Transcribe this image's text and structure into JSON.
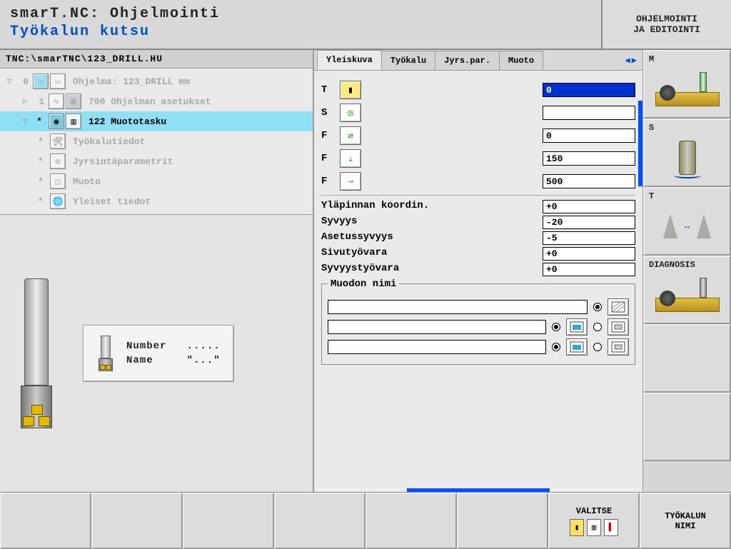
{
  "header": {
    "title": "smarT.NC: Ohjelmointi",
    "subtitle": "Työkalun kutsu",
    "mode_line1": "OHJELMOINTI",
    "mode_line2": "JA EDITOINTI"
  },
  "filepath": "TNC:\\smarTNC\\123_DRILL.HU",
  "tree": {
    "item0": {
      "idx": "0",
      "label": "Ohjelma: 123_DRILL mm"
    },
    "item1": {
      "idx": "1",
      "label": "700 Ohjelman asetukset"
    },
    "item2": {
      "idx": "*",
      "label": "122 Muototasku"
    },
    "item3": {
      "label": "Työkalutiedot"
    },
    "item4": {
      "label": "Jyrsintäparametrit"
    },
    "item5": {
      "label": "Muoto"
    },
    "item6": {
      "label": "Yleiset tiedot"
    }
  },
  "preview": {
    "number_label": "Number",
    "number_value": ".....",
    "name_label": "Name",
    "name_value": "\"...\""
  },
  "tabs": {
    "t1": "Yleiskuva",
    "t2": "Työkalu",
    "t3": "Jyrs.par.",
    "t4": "Muoto"
  },
  "params": {
    "T": {
      "label": "T",
      "value": "0"
    },
    "S": {
      "label": "S",
      "value": ""
    },
    "F1": {
      "label": "F",
      "value": "0"
    },
    "F2": {
      "label": "F",
      "value": "150"
    },
    "F3": {
      "label": "F",
      "value": "500"
    }
  },
  "coords": {
    "top": {
      "label": "Yläpinnan koordin.",
      "value": "+0"
    },
    "depth": {
      "label": "Syvyys",
      "value": "-20"
    },
    "step": {
      "label": "Asetussyvyys",
      "value": "-5"
    },
    "side": {
      "label": "Sivutyövara",
      "value": "+0"
    },
    "depthallow": {
      "label": "Syvyystyövara",
      "value": "+0"
    }
  },
  "shape": {
    "legend": "Muodon nimi"
  },
  "sidebar": {
    "M": "M",
    "S": "S",
    "T": "T",
    "DIAG": "DIAGNOSIS"
  },
  "footer": {
    "valitse": "VALITSE",
    "tool_name_l1": "TYÖKALUN",
    "tool_name_l2": "NIMI"
  }
}
